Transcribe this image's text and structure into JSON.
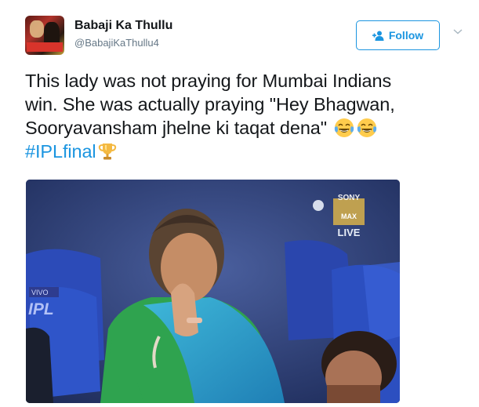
{
  "tweet": {
    "display_name": "Babaji Ka Thullu",
    "handle": "@BabajiKaThullu4",
    "follow_label": "Follow",
    "text_lines": [
      "This lady was not praying for Mumbai Indians",
      "win. She was actually praying \"Hey Bhagwan,",
      "Sooryavansham jhelne ki taqat dena\""
    ],
    "hashtag": "#IPLfinal",
    "emojis": [
      "face-with-tears-of-joy",
      "face-with-tears-of-joy",
      "trophy"
    ]
  },
  "media": {
    "broadcaster_lines": [
      "SONY",
      "MAX",
      "LIVE"
    ],
    "sponsor_lines": [
      "VIVO",
      "IPL"
    ]
  },
  "colors": {
    "link_blue": "#1b95e0",
    "text_dark": "#14171a",
    "text_muted": "#657786",
    "stadium_blue": "#2a3f77",
    "saree_green": "#2fa34f"
  }
}
